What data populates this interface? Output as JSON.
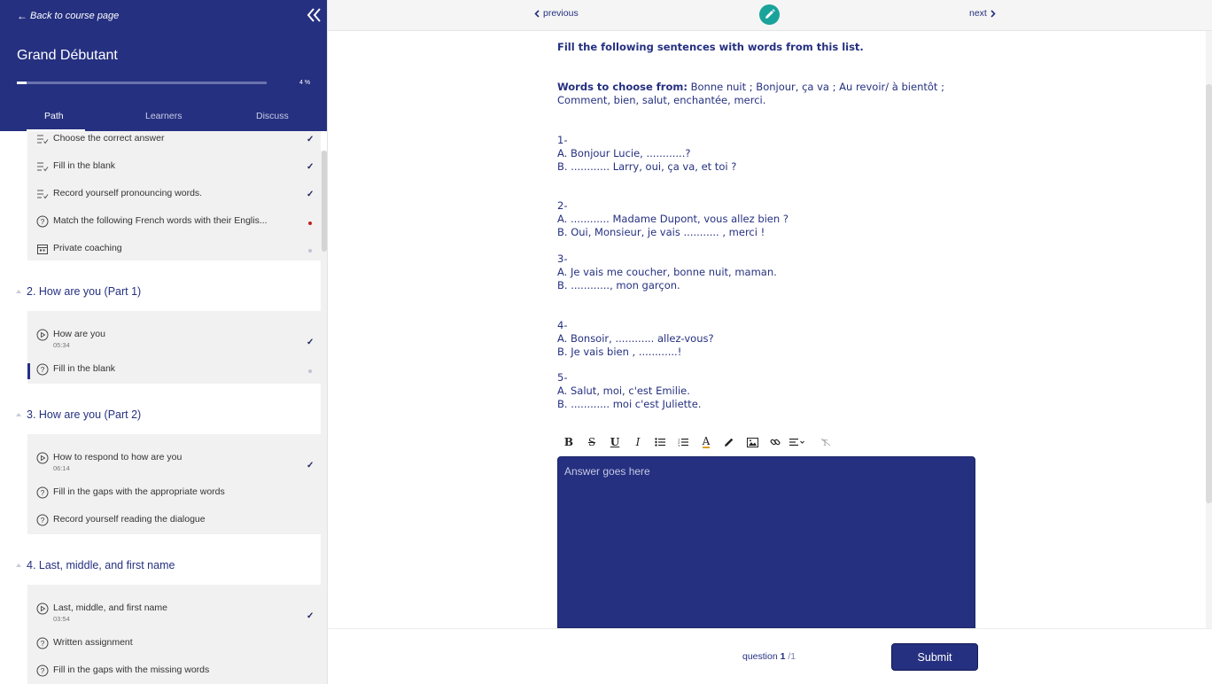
{
  "sidebar": {
    "back_label": "Back to course page",
    "course_title": "Grand Débutant",
    "progress_value": 4,
    "progress_label": "4 %",
    "tabs": [
      "Path",
      "Learners",
      "Discuss"
    ],
    "active_tab": "Path",
    "groups": [
      {
        "items": [
          {
            "title": "Choose the correct answer",
            "icon": "checklist-icon",
            "status": "done"
          },
          {
            "title": "Fill in the blank",
            "icon": "checklist-icon",
            "status": "done"
          },
          {
            "title": "Record yourself pronouncing words.",
            "icon": "checklist-icon",
            "status": "done"
          },
          {
            "title": "Match the following French words with their Englis...",
            "icon": "question-icon",
            "status": "incomplete"
          },
          {
            "title": "Private coaching",
            "icon": "calendar-icon",
            "status": "pending"
          }
        ]
      },
      {
        "title": "2. How are you (Part 1)",
        "items": [
          {
            "title": "How are you",
            "time": "05:34",
            "icon": "play-icon",
            "status": "done"
          },
          {
            "title": "Fill in the blank",
            "icon": "question-icon",
            "status": "pending",
            "active": true
          }
        ]
      },
      {
        "title": "3. How are you (Part 2)",
        "items": [
          {
            "title": "How to respond to how are you",
            "time": "06:14",
            "icon": "play-icon",
            "status": "done"
          },
          {
            "title": "Fill in the gaps with the appropriate words",
            "icon": "question-icon",
            "status": "none"
          },
          {
            "title": "Record yourself reading the dialogue",
            "icon": "question-icon",
            "status": "none"
          }
        ]
      },
      {
        "title": "4. Last, middle, and first name",
        "items": [
          {
            "title": "Last, middle, and first name",
            "time": "03:54",
            "icon": "play-icon",
            "status": "done"
          },
          {
            "title": "Written assignment",
            "icon": "question-icon",
            "status": "none"
          },
          {
            "title": "Fill in the gaps with the missing words",
            "icon": "question-icon",
            "status": "none"
          }
        ]
      }
    ]
  },
  "nav": {
    "previous_label": "previous",
    "next_label": "next"
  },
  "question": {
    "instruction": "Fill the following sentences with words from this list.",
    "words_label": "Words to choose from:",
    "words_line1": " Bonne nuit ; Bonjour, ça va ; Au revoir/ à bientôt ;",
    "words_line2": "Comment, bien, salut, enchantée, merci.",
    "lines": [
      "1-",
      "A.  Bonjour Lucie, ............?",
      "B. ............ Larry, oui, ça va, et toi ?",
      "2-",
      "A. ............ Madame Dupont, vous allez bien ?",
      "B. Oui, Monsieur, je vais ........... , merci !",
      "3-",
      "A. Je vais me coucher, bonne nuit, maman.",
      "B. ............, mon garçon.",
      "4-",
      "A. Bonsoir, ............ allez-vous?",
      "B. Je vais bien , ............!",
      "5-",
      "A. Salut, moi, c'est Emilie.",
      "B. ............ moi c'est Juliette."
    ]
  },
  "editor": {
    "toolbar": [
      {
        "name": "bold-button",
        "glyph": "B"
      },
      {
        "name": "strikethrough-button",
        "glyph": "S"
      },
      {
        "name": "underline-button",
        "glyph": "U"
      },
      {
        "name": "italic-button",
        "glyph": "I"
      },
      {
        "name": "bullet-list-button",
        "glyph": "bullets"
      },
      {
        "name": "numbered-list-button",
        "glyph": "numbers"
      },
      {
        "name": "text-color-button",
        "glyph": "A"
      },
      {
        "name": "highlight-button",
        "glyph": "pen"
      },
      {
        "name": "image-button",
        "glyph": "image"
      },
      {
        "name": "link-button",
        "glyph": "link"
      },
      {
        "name": "align-button",
        "glyph": "align"
      },
      {
        "name": "clear-format-button",
        "glyph": "clear"
      }
    ],
    "placeholder": "Answer goes here",
    "value": ""
  },
  "footer": {
    "question_label": "question",
    "question_current": "1",
    "question_total": "/1",
    "submit_label": "Submit"
  },
  "colors": {
    "primary": "#253080",
    "accent": "#1aa39a",
    "alert": "#c0231e"
  }
}
